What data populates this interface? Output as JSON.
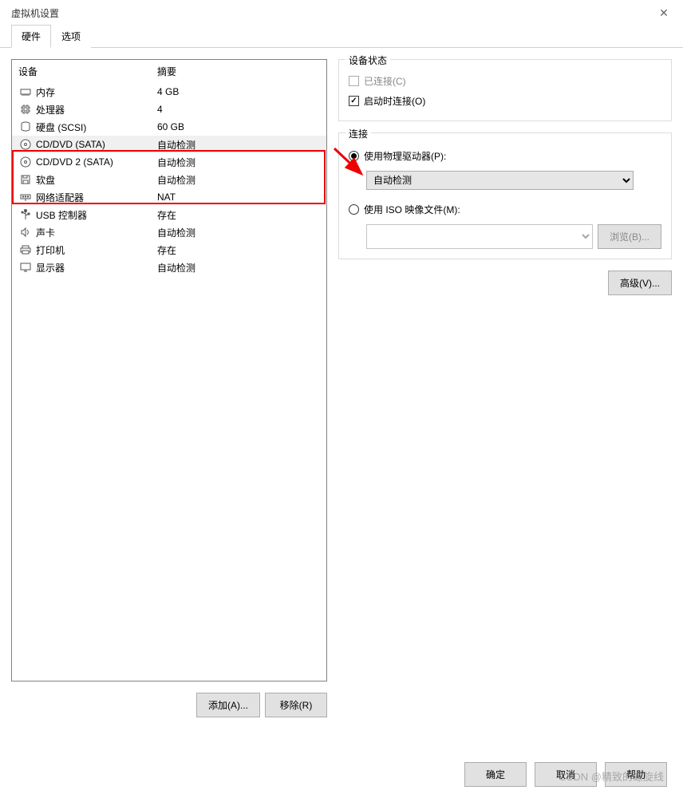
{
  "window": {
    "title": "虚拟机设置"
  },
  "tabs": {
    "hardware": "硬件",
    "options": "选项"
  },
  "table": {
    "header_device": "设备",
    "header_summary": "摘要",
    "rows": [
      {
        "icon": "memory",
        "device": "内存",
        "summary": "4 GB"
      },
      {
        "icon": "cpu",
        "device": "处理器",
        "summary": "4"
      },
      {
        "icon": "disk",
        "device": "硬盘 (SCSI)",
        "summary": "60 GB"
      },
      {
        "icon": "cd",
        "device": "CD/DVD (SATA)",
        "summary": "自动检测"
      },
      {
        "icon": "cd",
        "device": "CD/DVD 2 (SATA)",
        "summary": "自动检测"
      },
      {
        "icon": "floppy",
        "device": "软盘",
        "summary": "自动检测"
      },
      {
        "icon": "network",
        "device": "网络适配器",
        "summary": "NAT"
      },
      {
        "icon": "usb",
        "device": "USB 控制器",
        "summary": "存在"
      },
      {
        "icon": "sound",
        "device": "声卡",
        "summary": "自动检测"
      },
      {
        "icon": "printer",
        "device": "打印机",
        "summary": "存在"
      },
      {
        "icon": "display",
        "device": "显示器",
        "summary": "自动检测"
      }
    ]
  },
  "left_buttons": {
    "add": "添加(A)...",
    "remove": "移除(R)"
  },
  "device_status": {
    "title": "设备状态",
    "connected": "已连接(C)",
    "connect_on_poweron": "启动时连接(O)"
  },
  "connection": {
    "title": "连接",
    "use_physical": "使用物理驱动器(P):",
    "physical_options": [
      "自动检测"
    ],
    "use_iso": "使用 ISO 映像文件(M):",
    "iso_value": "",
    "browse": "浏览(B)..."
  },
  "advanced": "高级(V)...",
  "footer": {
    "ok": "确定",
    "cancel": "取消",
    "help": "帮助"
  },
  "watermark": "CSDN @精致的螺旋线"
}
